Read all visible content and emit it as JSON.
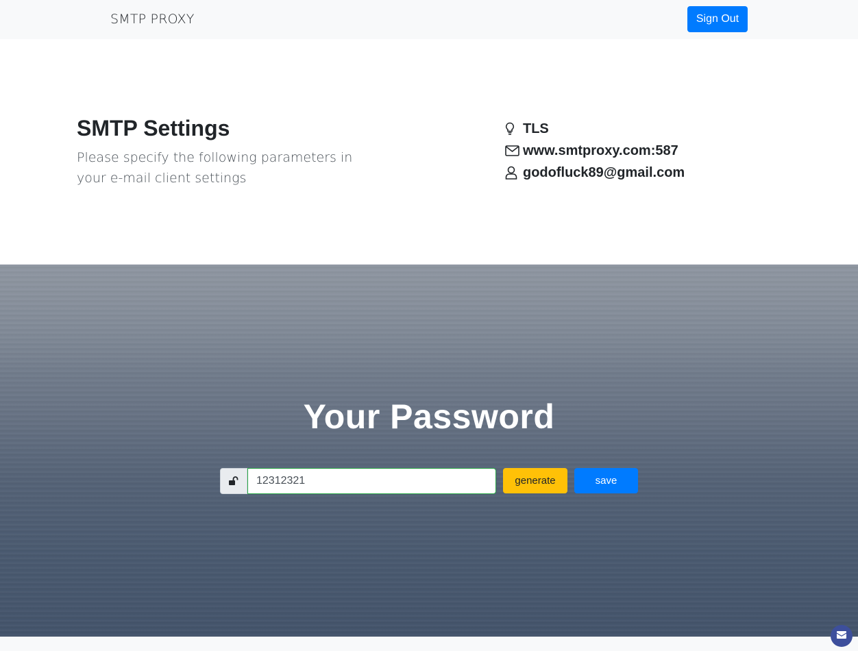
{
  "navbar": {
    "brand": "SMTP PROXY",
    "sign_out_label": "Sign Out"
  },
  "settings": {
    "title": "SMTP Settings",
    "description": "Please specify the following parameters in your e-mail client settings",
    "items": [
      {
        "icon": "lightbulb-icon",
        "value": "TLS"
      },
      {
        "icon": "envelope-icon",
        "value": "www.smtproxy.com:587"
      },
      {
        "icon": "user-icon",
        "value": "godofluck89@gmail.com"
      }
    ]
  },
  "password": {
    "title": "Your Password",
    "value": "12312321",
    "lock_icon": "unlock-icon",
    "generate_label": "generate",
    "save_label": "save"
  },
  "chat": {
    "icon": "envelope-icon"
  },
  "colors": {
    "primary": "#007bff",
    "warning": "#ffc107",
    "input_valid_border": "#28a745",
    "navbar_bg": "#f8f9fa",
    "chat_button": "#3d4f9c"
  }
}
